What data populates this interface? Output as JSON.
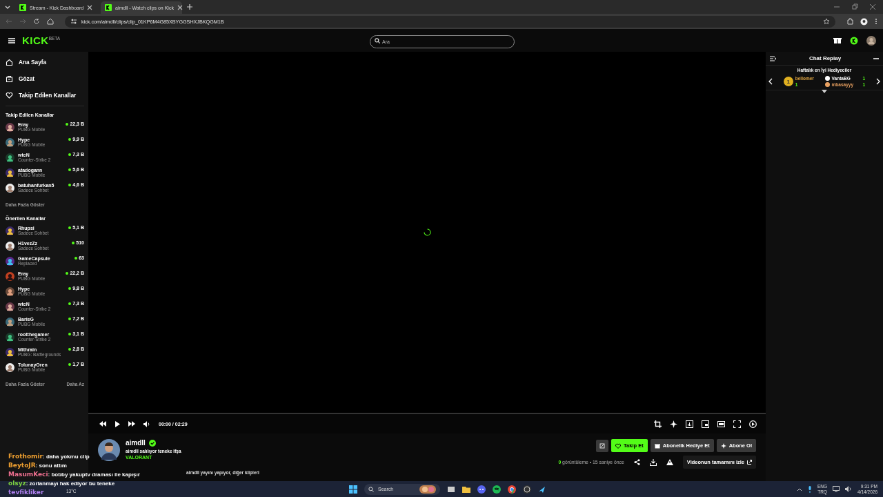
{
  "browser": {
    "tabs": [
      {
        "title": "Stream - Kick Dashboard",
        "selected": false
      },
      {
        "title": "aimdll - Watch clips on Kick",
        "selected": true
      }
    ],
    "url": "kick.com/aimdll/clips/clip_01KP6M4G85XBYGGSHXJBKQGM1B"
  },
  "header": {
    "logo": "KICK",
    "logo_badge": "BETA",
    "search": {
      "placeholder": "Ara"
    }
  },
  "nav": [
    {
      "label": "Ana Sayfa"
    },
    {
      "label": "Gözat"
    },
    {
      "label": "Takip Edilen Kanallar"
    }
  ],
  "followed": {
    "title": "Takip Edilen Kanallar",
    "more": "Daha Fazla Göster",
    "channels": [
      {
        "name": "Eray",
        "game": "PUBG Mobile",
        "viewers": "22,3 B"
      },
      {
        "name": "Hype",
        "game": "PUBG Mobile",
        "viewers": "9,9 B"
      },
      {
        "name": "wtcN",
        "game": "Counter-Strike 2",
        "viewers": "7,3 B"
      },
      {
        "name": "atadogann",
        "game": "PUBG Mobile",
        "viewers": "5,6 B"
      },
      {
        "name": "batuhanfurkan5",
        "game": "Sadece Sohbet",
        "viewers": "4,6 B"
      }
    ]
  },
  "recommended": {
    "title": "Önerilen Kanallar",
    "more": "Daha Fazla Göster",
    "less": "Daha Az",
    "channels": [
      {
        "name": "Rhupsi",
        "game": "Sadece Sohbet",
        "viewers": "5,1 B"
      },
      {
        "name": "H1vezZz",
        "game": "Sadece Sohbet",
        "viewers": "510"
      },
      {
        "name": "GameCapsule",
        "game": "Replaced",
        "viewers": "63"
      },
      {
        "name": "Eray",
        "game": "PUBG Mobile",
        "viewers": "22,2 B"
      },
      {
        "name": "Hype",
        "game": "PUBG Mobile",
        "viewers": "9,8 B"
      },
      {
        "name": "wtcN",
        "game": "Counter-Strike 2",
        "viewers": "7,3 B"
      },
      {
        "name": "BarisG",
        "game": "PUBG Mobile",
        "viewers": "7,2 B"
      },
      {
        "name": "rootthegamer",
        "game": "Counter-Strike 2",
        "viewers": "3,1 B"
      },
      {
        "name": "Mithrain",
        "game": "PUBG: Battlegrounds",
        "viewers": "2,8 B"
      },
      {
        "name": "TolunayOren",
        "game": "PUBG Mobile",
        "viewers": "1,7 B"
      }
    ]
  },
  "player": {
    "time": "00:00 / 02:29"
  },
  "streamer": {
    "name": "aimdll",
    "verified": true,
    "title": "aimdll salılıyor teneke ifşa",
    "category": "VALORANT",
    "note": "aimdll yayını yapıyor, diğer klipleri"
  },
  "actions": {
    "follow": "Takip Et",
    "gift": "Abonelik Hediye Et",
    "subscribe": "Abone Ol"
  },
  "stats": {
    "views": "0",
    "views_label": "görüntüleme",
    "separator": "•",
    "age": "15 saniye önce",
    "watch_full": "Videonun tamamını izle"
  },
  "chat": {
    "title": "Chat Replay",
    "leaderboard_title": "Haftalık en İyi Hediyeciler",
    "top": {
      "rank": "1",
      "name": "bellomer",
      "count": "1"
    },
    "others": [
      {
        "name": "VantaBG",
        "count": "1",
        "color": "#ffffff"
      },
      {
        "name": "mbasayyy",
        "count": "1",
        "color": "#e8a060"
      }
    ]
  },
  "overlay_messages": [
    {
      "user": "Frothomir",
      "text": ": daha yokmu clip",
      "color": "#f0a030"
    },
    {
      "user": "BeytoJR",
      "text": ": sonu attım",
      "color": "#f0a030"
    },
    {
      "user": "MasumKeci",
      "text": ": bobby yakuptv draması ile kapışır",
      "color": "#f07090"
    },
    {
      "user": "olsyz",
      "text": ": zorlanmayı hak ediyor bu teneke",
      "color": "#7cd040"
    },
    {
      "user": "tevfikliker",
      "color": "#b080f0"
    }
  ],
  "taskbar": {
    "weather": "13°C",
    "search": "Search",
    "lang": "ENG",
    "layout": "TRQ",
    "time": "9:31 PM",
    "date": "4/14/2026"
  }
}
